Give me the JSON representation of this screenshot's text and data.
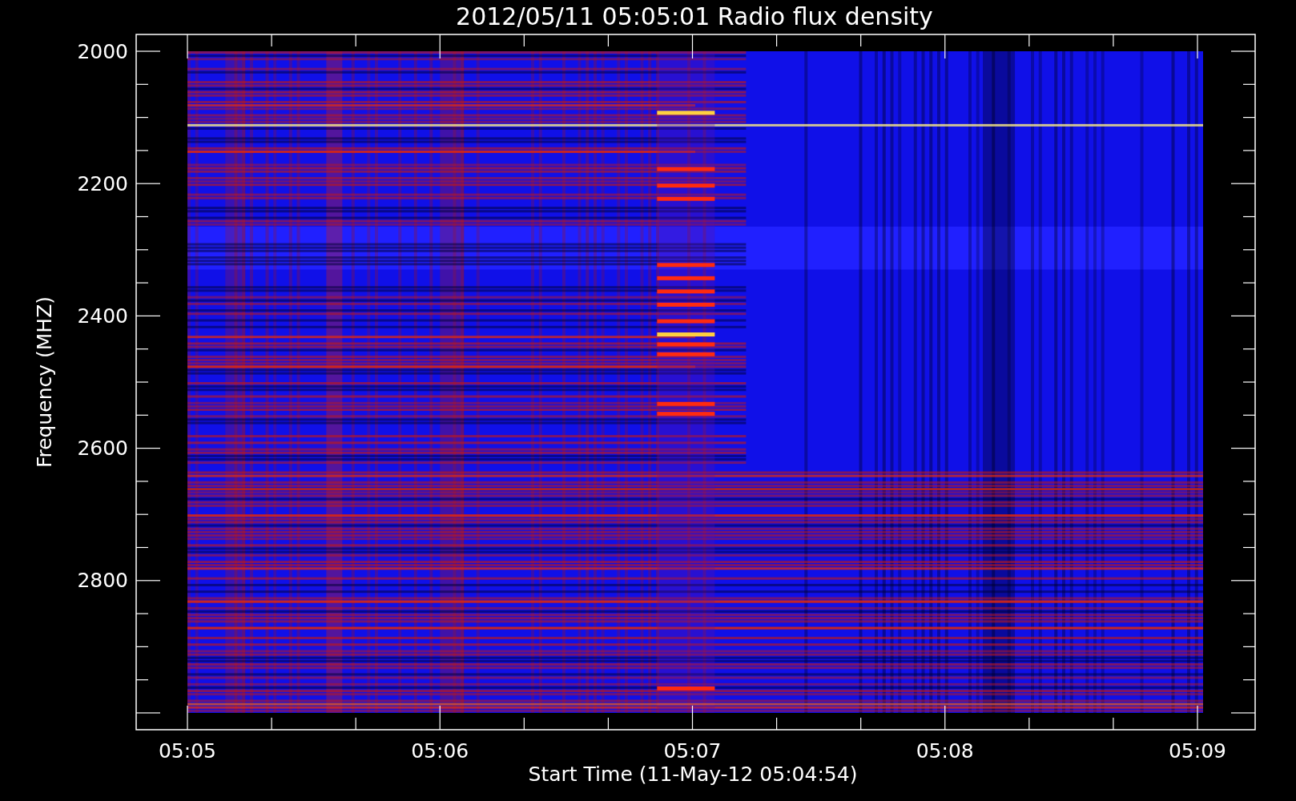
{
  "plot": {
    "title": "2012/05/11 05:05:01 Radio flux density",
    "ylabel": "Frequency (MHZ)",
    "xlabel": "Start Time (11-May-12 05:04:54)",
    "yticks": [
      "2000",
      "2200",
      "2400",
      "2600",
      "2800"
    ],
    "xticks": [
      "05:05",
      "05:06",
      "05:07",
      "05:08",
      "05:09"
    ]
  }
}
